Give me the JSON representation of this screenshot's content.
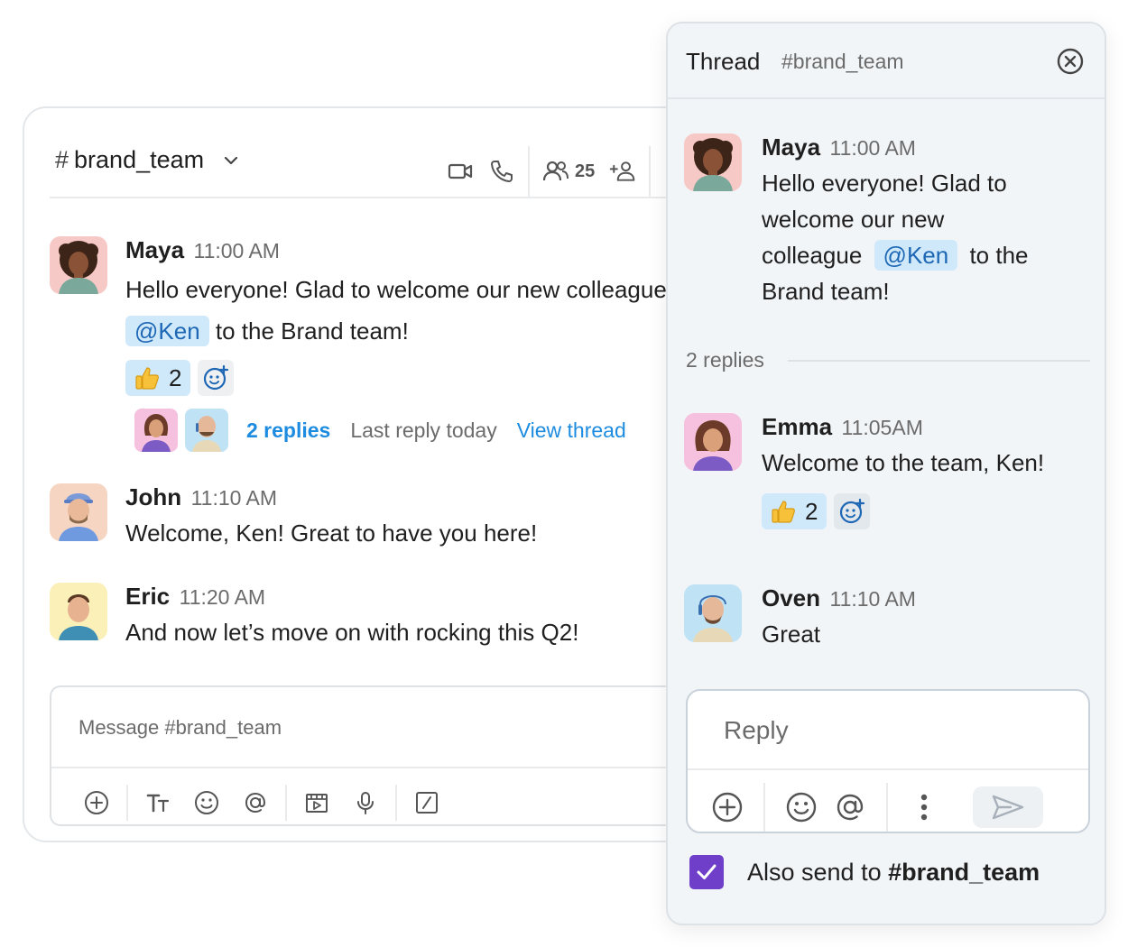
{
  "channel": {
    "hash": "#",
    "name": "brand_team",
    "member_count": "25",
    "icons": [
      "chevron-down-icon",
      "video-icon",
      "phone-icon",
      "members-icon",
      "add-member-icon"
    ]
  },
  "messages": [
    {
      "author": "Maya",
      "time": "11:00 AM",
      "text_before": "Hello everyone! Glad to welcome our new colleague",
      "mention": "@Ken",
      "text_after": "to the Brand team!",
      "reaction": {
        "emoji": "thumbs-up-icon",
        "count": "2"
      },
      "thread": {
        "replies": "2 replies",
        "last_reply": "Last reply today",
        "view": "View thread"
      }
    },
    {
      "author": "John",
      "time": "11:10 AM",
      "text": "Welcome, Ken! Great to have you here!"
    },
    {
      "author": "Eric",
      "time": "11:20 AM",
      "text": "And now let’s move on with rocking this Q2!"
    }
  ],
  "composer": {
    "placeholder": "Message #brand_team",
    "tools": [
      "plus-circle-icon",
      "text-format-icon",
      "emoji-icon",
      "mention-icon",
      "media-icon",
      "microphone-icon",
      "slash-command-icon"
    ]
  },
  "thread_panel": {
    "title": "Thread",
    "channel": "#brand_team",
    "parent": {
      "author": "Maya",
      "time": "11:00 AM",
      "line1": "Hello everyone! Glad to",
      "line2": "welcome our new",
      "line3_before": "colleague",
      "mention": "@Ken",
      "line3_after": "to the",
      "line4": "Brand team!"
    },
    "replies_label": "2 replies",
    "replies": [
      {
        "author": "Emma",
        "time": "11:05AM",
        "text": "Welcome to the team, Ken!",
        "reaction": {
          "emoji": "thumbs-up-icon",
          "count": "2"
        }
      },
      {
        "author": "Oven",
        "time": "11:10 AM",
        "text": "Great"
      }
    ],
    "composer": {
      "placeholder": "Reply"
    },
    "also_send": {
      "prefix": "Also send to ",
      "channel": "#brand_team",
      "checked": true
    }
  },
  "colors": {
    "accent": "#1d8ce0",
    "mention_bg": "#cfe9fb",
    "checkbox": "#6f3fc9",
    "panel_bg": "#f2f5f8"
  }
}
